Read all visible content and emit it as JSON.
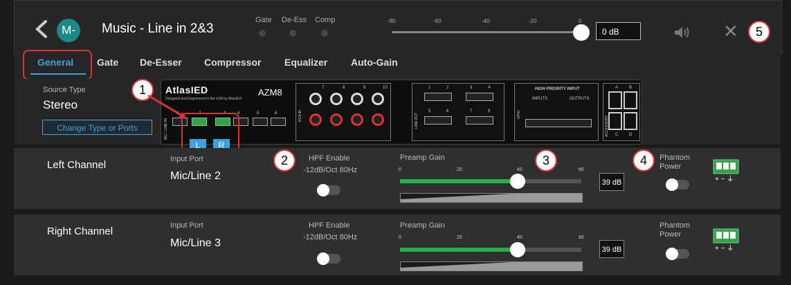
{
  "header": {
    "avatar_text": "M-",
    "title": "Music - Line in 2&3",
    "indicators": [
      "Gate",
      "De-Ess",
      "Comp"
    ],
    "meter_ticks": [
      "-80",
      "-60",
      "-40",
      "-20",
      "0"
    ],
    "master_level_fraction": 1.0,
    "level_value": "0 dB"
  },
  "tabs": [
    "General",
    "Gate",
    "De-Esser",
    "Compressor",
    "Equalizer",
    "Auto-Gain"
  ],
  "active_tab": "General",
  "general": {
    "source_type_label": "Source Type",
    "source_type_value": "Stereo",
    "change_button": "Change Type or Ports"
  },
  "device": {
    "brand": "AtlasIED",
    "tagline": "Designed and Engineered in the USA by AtlasIED",
    "model": "AZM8",
    "mic_line_in_label": "MIC / LINE IN",
    "rca_label": "RCA IN",
    "line_out_label": "LINE OUT",
    "gpio_label": "GPIO",
    "accessory_label": "ACCESSORY",
    "high_priority_label": "HIGH PRIORITY INPUT",
    "inputs_label": "INPUTS",
    "outputs_label": "OUTPUTS",
    "mic_ports": [
      "1",
      "2",
      "3",
      "4",
      "5",
      "6"
    ],
    "rca_ports": [
      "7",
      "8",
      "9",
      "10"
    ],
    "line_out_ports": [
      "1",
      "2",
      "3",
      "4",
      "5",
      "6",
      "7",
      "8"
    ],
    "accessory_ports": [
      "A",
      "B",
      "C",
      "D"
    ],
    "selected_left": "L",
    "selected_right": "R"
  },
  "callouts": [
    "1",
    "2",
    "3",
    "4",
    "5"
  ],
  "channels": [
    {
      "name": "Left Channel",
      "input_port_label": "Input Port",
      "input_port": "Mic/Line 2",
      "hpf_label": "HPF Enable",
      "hpf_value": "-12dB/Oct 80Hz",
      "hpf_enabled": false,
      "preamp_label": "Preamp Gain",
      "gain_ticks": [
        "0",
        "20",
        "40",
        "60"
      ],
      "gain": 39,
      "gain_max": 60,
      "gain_display": "39 dB",
      "phantom_label_1": "Phantom",
      "phantom_label_2": "Power",
      "phantom_enabled": false
    },
    {
      "name": "Right Channel",
      "input_port_label": "Input Port",
      "input_port": "Mic/Line 3",
      "hpf_label": "HPF Enable",
      "hpf_value": "-12dB/Oct 80Hz",
      "hpf_enabled": false,
      "preamp_label": "Preamp Gain",
      "gain_ticks": [
        "0",
        "20",
        "40",
        "60"
      ],
      "gain": 39,
      "gain_max": 60,
      "gain_display": "39 dB",
      "phantom_label_1": "Phantom",
      "phantom_label_2": "Power",
      "phantom_enabled": false
    }
  ],
  "colors": {
    "accent": "#3aa3e0",
    "gain_fill": "#22b14c",
    "callout_border": "#d33",
    "background": "#1b1b1b"
  },
  "icons": [
    "back-chevron-icon",
    "speaker-icon",
    "close-icon",
    "phantom-terminal-icon"
  ]
}
